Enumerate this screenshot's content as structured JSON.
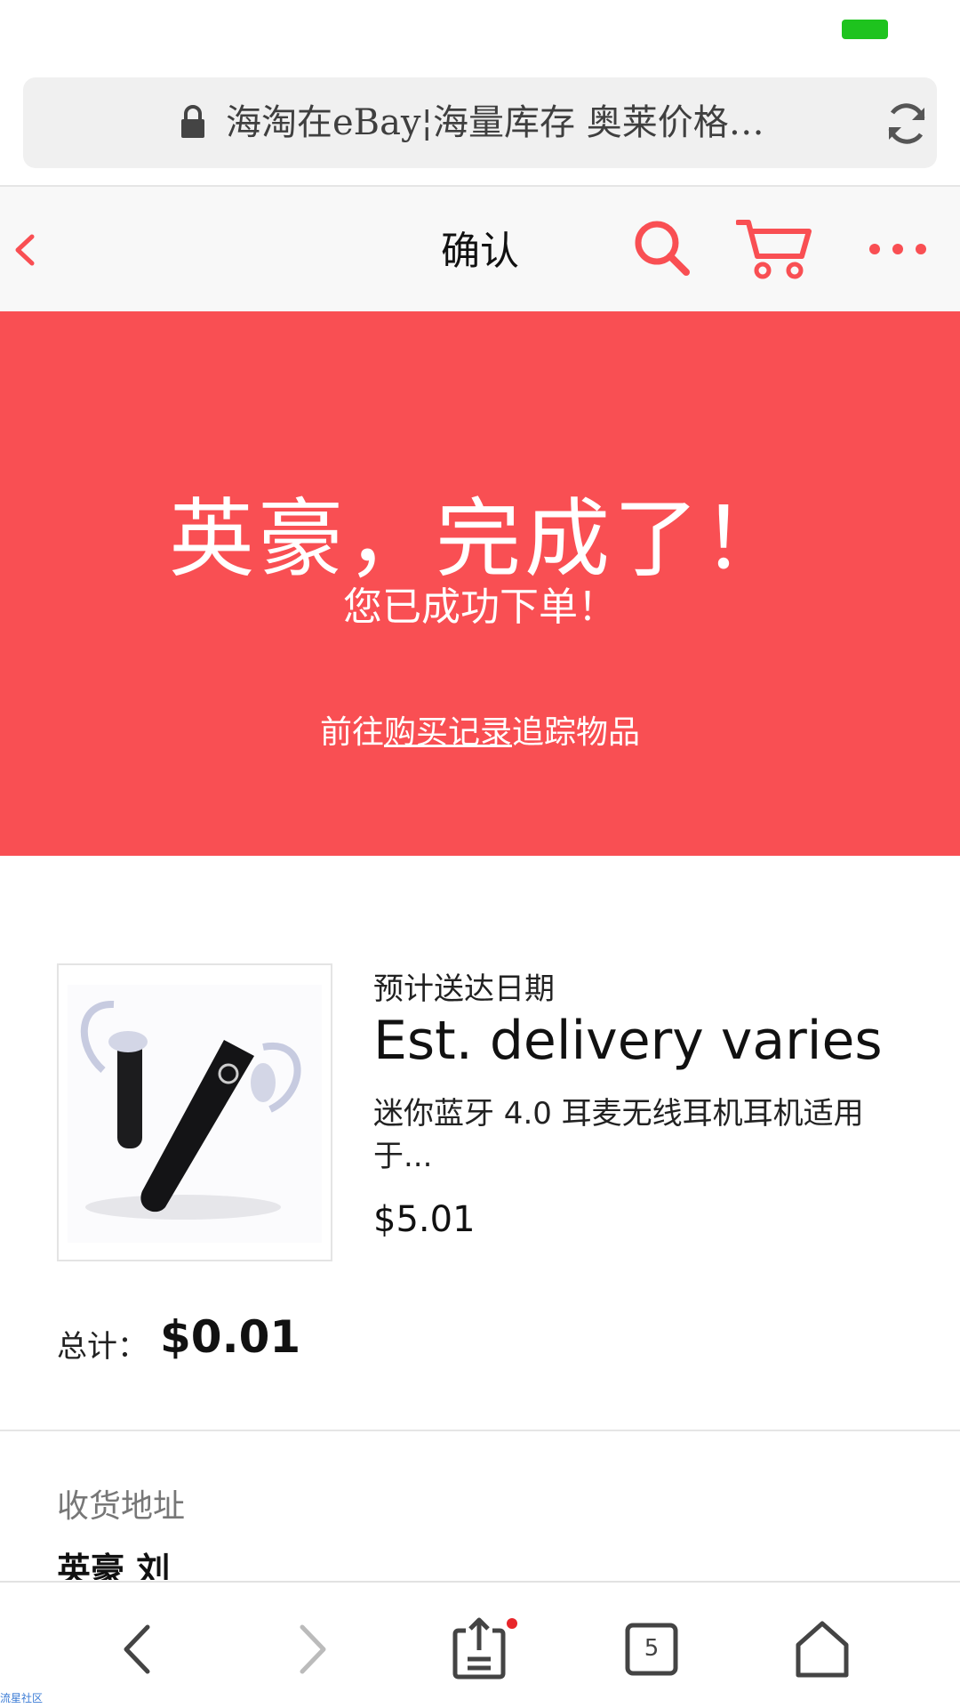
{
  "browser": {
    "url_text": "海淘在eBay¦海量库存 奥莱价格…",
    "open_tabs_count": "5"
  },
  "nav": {
    "title": "确认"
  },
  "banner": {
    "title": "英豪，完成了！",
    "subtitle": "您已成功下单！",
    "link_prefix": "前往",
    "link_text": "购买记录",
    "link_suffix": "追踪物品"
  },
  "order_item": {
    "est_label": "预计送达日期",
    "est_value": "Est. delivery varies",
    "title": "迷你蓝牙 4.0 耳麦无线耳机耳机适用于...",
    "price": "$5.01"
  },
  "total": {
    "label": "总计：",
    "value": "$0.01"
  },
  "shipping": {
    "label": "收货地址",
    "name": "英豪 刘"
  },
  "watermark": "流星社区",
  "colors": {
    "accent": "#f94f53",
    "battery": "#1ec31e",
    "badge": "#e8262b"
  }
}
